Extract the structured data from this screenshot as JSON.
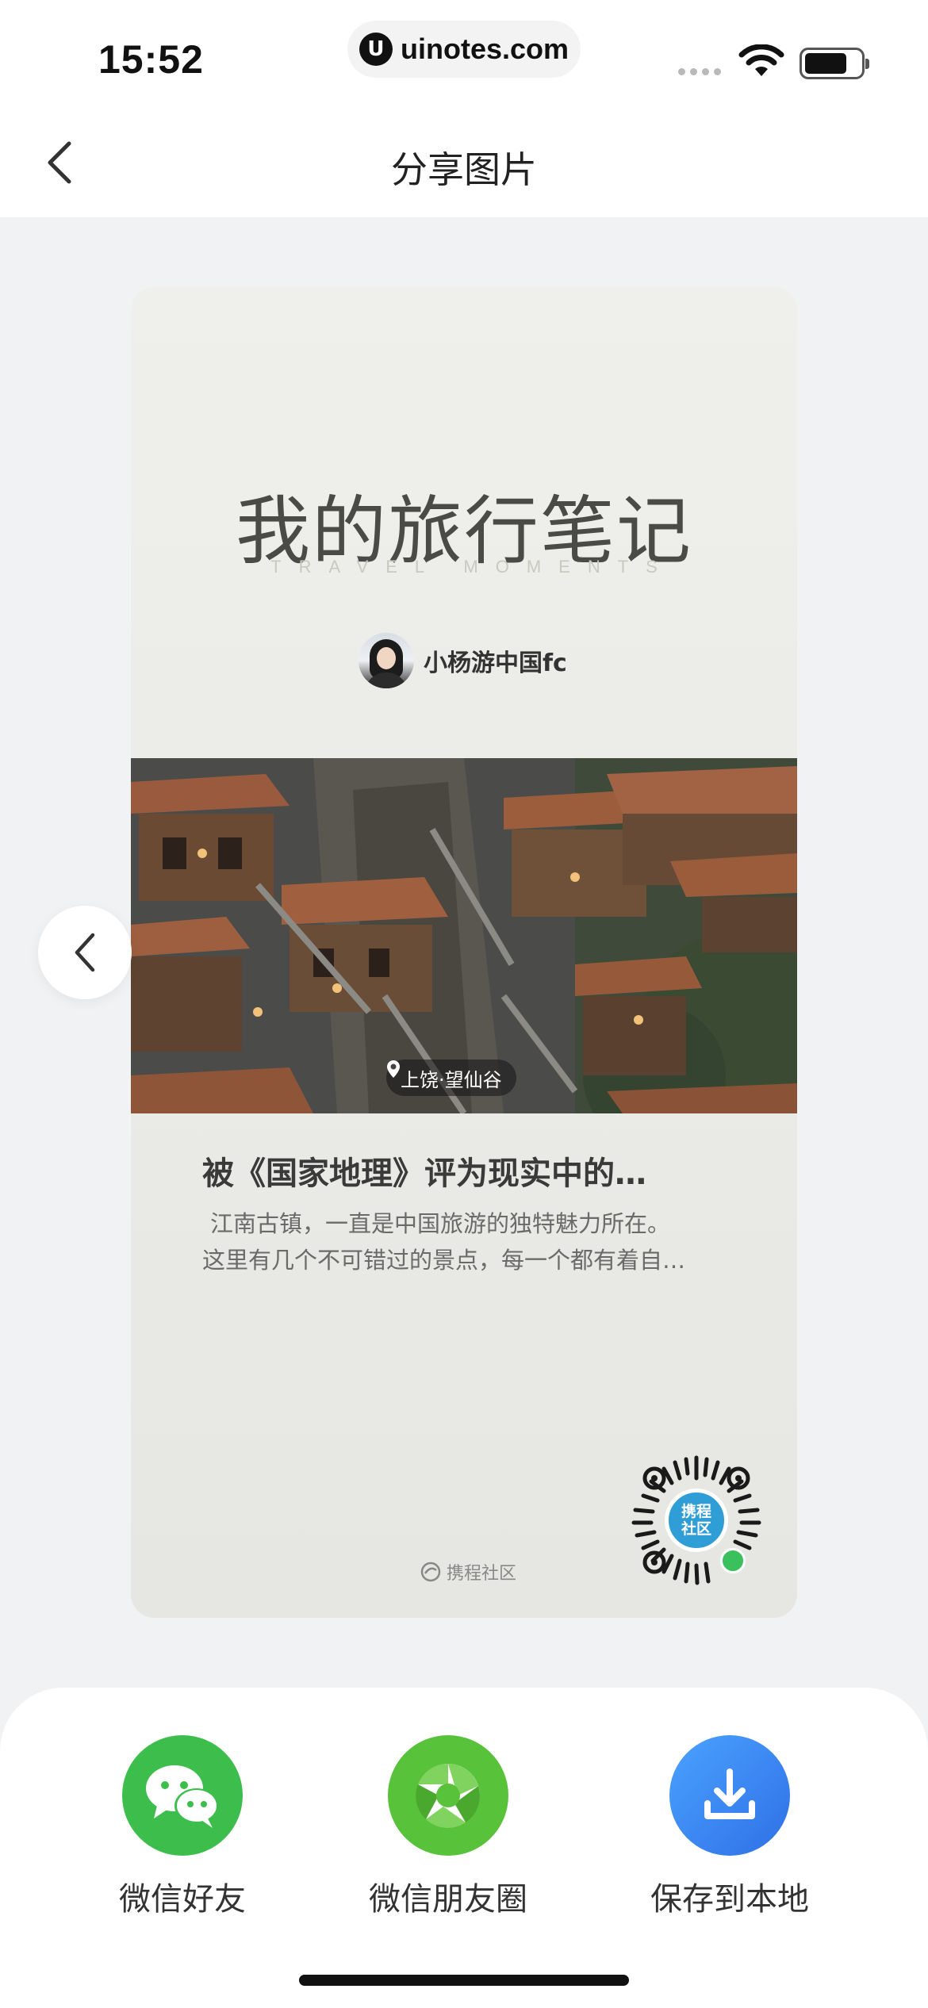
{
  "status_bar": {
    "time": "15:52",
    "url": "uinotes.com",
    "url_logo": "U"
  },
  "header": {
    "title": "分享图片"
  },
  "card": {
    "title": "我的旅行笔记",
    "subtitle": "TRAVEL MOMENTS",
    "author": "小杨游中国fc",
    "location": "上饶·望仙谷",
    "post_title": "被《国家地理》评为现实中的…",
    "excerpt_lines": [
      "江南古镇，一直是中国旅游的独特魅力所在。",
      "这里有几个不可错过的景点，每一个都有着自…"
    ],
    "brand": "携程社区",
    "qr_label_line1": "携程",
    "qr_label_line2": "社区"
  },
  "share": {
    "items": [
      {
        "label": "微信好友",
        "icon": "wechat-icon",
        "color": "#3dbe4c"
      },
      {
        "label": "微信朋友圈",
        "icon": "moments-icon",
        "color": "#59c23b"
      },
      {
        "label": "保存到本地",
        "icon": "download-icon",
        "color": "#2f80ed"
      }
    ]
  }
}
